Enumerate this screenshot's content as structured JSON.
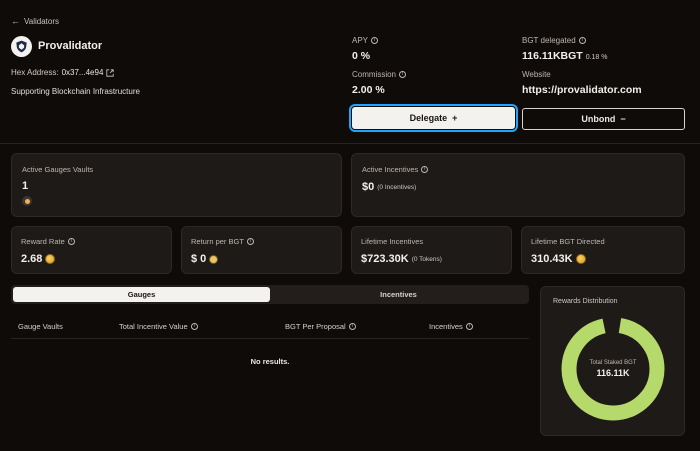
{
  "nav": {
    "back_label": "Validators"
  },
  "validator": {
    "name": "Provalidator",
    "hex_label": "Hex Address:",
    "hex_value": "0x37...4e94",
    "description": "Supporting Blockchain Infrastructure"
  },
  "stats": {
    "apy": {
      "label": "APY",
      "value": "0 %"
    },
    "bgt_delegated": {
      "label": "BGT delegated",
      "value": "116.11KBGT",
      "percent": "0.18 %"
    },
    "commission": {
      "label": "Commission",
      "value": "2.00 %"
    },
    "website": {
      "label": "Website",
      "value": "https://provalidator.com"
    }
  },
  "actions": {
    "delegate_label": "Delegate",
    "delegate_icon": "+",
    "unbond_label": "Unbond",
    "unbond_icon": "−"
  },
  "cards": {
    "active_gauges": {
      "label": "Active Gauges Vaults",
      "value": "1"
    },
    "active_incentives": {
      "label": "Active Incentives",
      "value": "$0",
      "note": "(0 Incentives)"
    },
    "reward_rate": {
      "label": "Reward Rate",
      "value": "2.68"
    },
    "return_per_bgt": {
      "label": "Return per BGT",
      "value": "$ 0"
    },
    "lifetime_incentives": {
      "label": "Lifetime Incentives",
      "value": "$723.30K",
      "note": "(0 Tokens)"
    },
    "lifetime_bgt": {
      "label": "Lifetime BGT Directed",
      "value": "310.43K"
    }
  },
  "tabs": [
    {
      "label": "Gauges",
      "active": true
    },
    {
      "label": "Incentives",
      "active": false
    }
  ],
  "table": {
    "columns": [
      "Gauge Vaults",
      "Total Incentive Value",
      "BGT Per Proposal",
      "Incentives"
    ],
    "empty_text": "No results."
  },
  "rewards_distribution": {
    "title": "Rewards Distribution",
    "center_label": "Total Staked BGT",
    "center_value": "116.11K",
    "ring_color": "#b5d96a"
  }
}
